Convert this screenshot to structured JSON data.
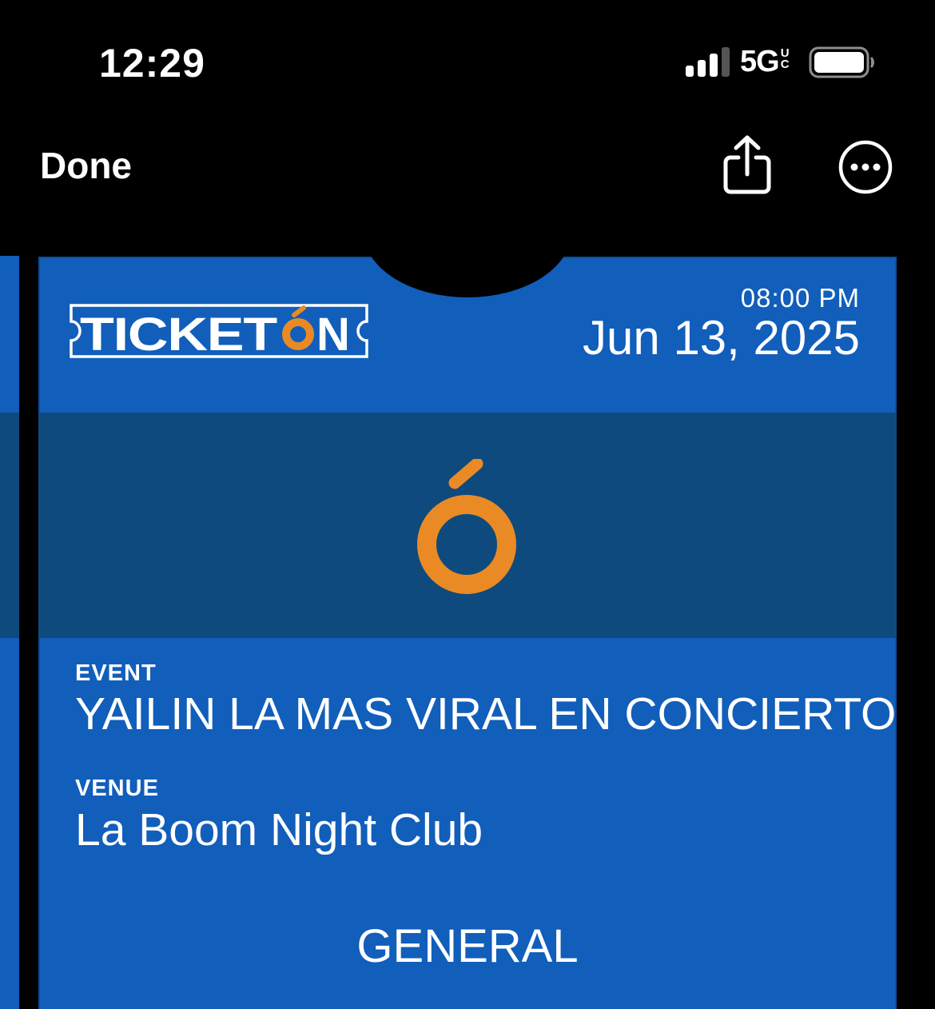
{
  "status_bar": {
    "time": "12:29",
    "network": "5G",
    "network_suffix_top": "U",
    "network_suffix_bottom": "C"
  },
  "nav": {
    "done_label": "Done",
    "share_icon": "share-icon",
    "more_icon": "ellipsis-circle-icon"
  },
  "pass": {
    "brand_text": "TICKETÓN",
    "time": "08:00 PM",
    "date": "Jun 13, 2025",
    "fields": {
      "event_label": "EVENT",
      "event_value": "YAILIN LA MAS VIRAL EN CONCIERTO",
      "venue_label": "VENUE",
      "venue_value": "La Boom Night Club"
    },
    "ticket_type": "GENERAL",
    "colors": {
      "pass_background": "#115ebb",
      "strip_background": "#0e4a7e",
      "accent_orange": "#ea8a25"
    }
  }
}
